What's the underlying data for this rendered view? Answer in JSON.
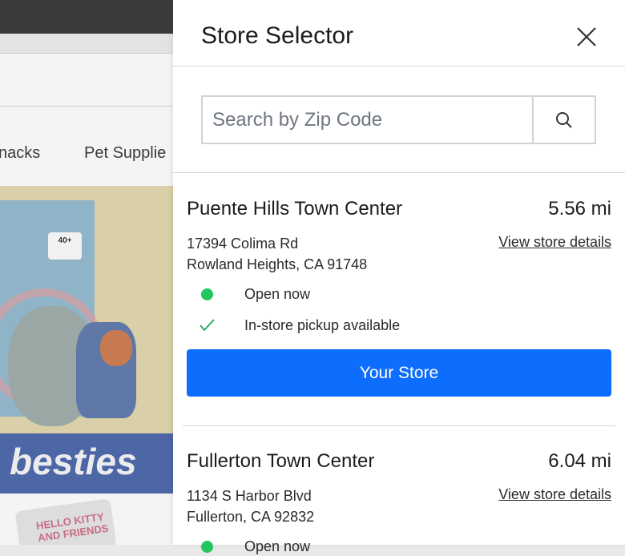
{
  "background": {
    "nav_items": [
      "nacks",
      "Pet Supplie"
    ],
    "hero_banner_text": "besties",
    "box_label": "40+",
    "card_text": "HELLO KITTY AND FRIENDS"
  },
  "drawer": {
    "title": "Store Selector",
    "search": {
      "placeholder": "Search by Zip Code",
      "value": ""
    },
    "stores": [
      {
        "name": "Puente Hills Town Center",
        "distance": "5.56 mi",
        "address_line1": "17394 Colima Rd",
        "address_line2": "Rowland Heights, CA 91748",
        "details_link": "View store details",
        "status": "Open now",
        "pickup": "In-store pickup available",
        "button_label": "Your Store"
      },
      {
        "name": "Fullerton Town Center",
        "distance": "6.04 mi",
        "address_line1": "1134 S Harbor Blvd",
        "address_line2": "Fullerton, CA 92832",
        "details_link": "View store details",
        "status": "Open now"
      }
    ]
  },
  "colors": {
    "primary": "#0d6efd",
    "open_dot": "#22c55e",
    "check": "#22a55a"
  },
  "icons": [
    "close-icon",
    "search-icon",
    "status-dot-icon",
    "check-icon"
  ]
}
